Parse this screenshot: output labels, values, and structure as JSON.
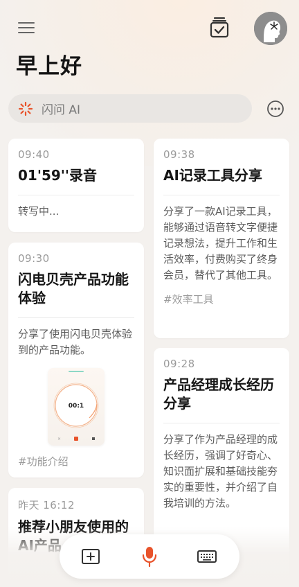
{
  "header": {
    "greeting": "早上好"
  },
  "search": {
    "placeholder": "闪问 AI"
  },
  "cards": [
    {
      "time": "09:40",
      "title": "01'59''录音",
      "body": "转写中..."
    },
    {
      "time": "09:30",
      "title": "闪电贝壳产品功能体验",
      "body": "分享了使用闪电贝壳体验到的产品功能。",
      "tag": "#功能介绍"
    },
    {
      "time": "昨天 16:12",
      "title": "推荐小朋友使用的AI产品"
    },
    {
      "time": "09:38",
      "title": "AI记录工具分享",
      "body": "分享了一款AI记录工具，能够通过语音转文字便捷记录想法，提升工作和生活效率，付费购买了终身会员，替代了其他工具。",
      "tag": "#效率工具"
    },
    {
      "time": "09:28",
      "title": "产品经理成长经历分享",
      "body": "分享了作为产品经理的成长经历，强调了好奇心、知识面扩展和基础技能夯实的重要性，并介绍了自我培训的方法。"
    }
  ],
  "thumb_timer": "00:1",
  "icons": {
    "menu": "menu-icon",
    "tasks": "task-check-icon",
    "avatar": "user-avatar",
    "spark": "spark-icon",
    "more": "more-icon",
    "add": "add-note-icon",
    "mic": "microphone-icon",
    "keyboard": "keyboard-icon"
  },
  "colors": {
    "accent": "#e8532b",
    "background": "#f4f1ee"
  }
}
